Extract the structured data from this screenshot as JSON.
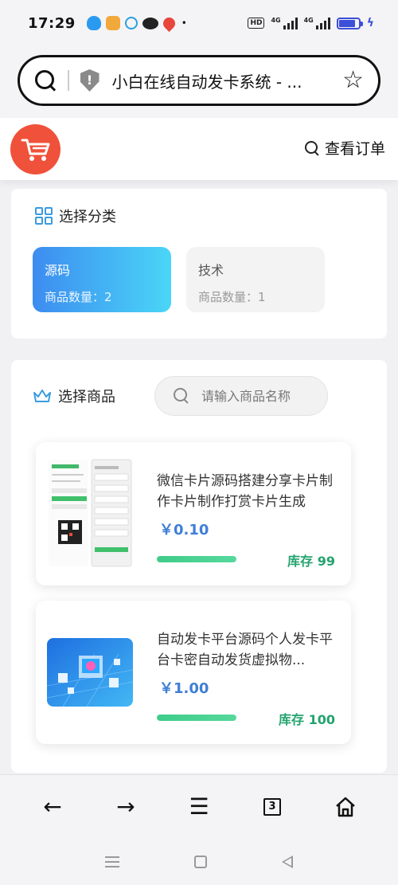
{
  "status_bar": {
    "time": "17:29",
    "dot": "•",
    "hd": "HD",
    "signal_1": "4G",
    "signal_2": "4G",
    "battery_percent": 85,
    "notification_icons": [
      "qq-icon",
      "video-icon",
      "chat-bubble-icon",
      "wechat-icon",
      "map-pin-icon"
    ]
  },
  "address_bar": {
    "title": "小白在线自动发卡系统 - ...",
    "security_icon": "shield-icon",
    "bookmark_icon": "star-icon"
  },
  "header": {
    "logo_icon": "shopping-cart-icon",
    "logo_color": "#f0513a",
    "order_link": "查看订单"
  },
  "category_section": {
    "title": "选择分类",
    "categories": [
      {
        "name": "源码",
        "count_label": "商品数量：2",
        "selected": true
      },
      {
        "name": "技术",
        "count_label": "商品数量：1",
        "selected": false
      }
    ]
  },
  "goods_section": {
    "title": "选择商品",
    "search_placeholder": "请输入商品名称",
    "products": [
      {
        "name": "微信卡片源码搭建分享卡片制作卡片制作打赏卡片生成",
        "price": "￥0.10",
        "stock_label": "库存 99",
        "stock_bar": 1.0
      },
      {
        "name": "自动发卡平台源码个人发卡平台卡密自动发货虚拟物...",
        "price": "￥1.00",
        "stock_label": "库存 100",
        "stock_bar": 1.0
      }
    ]
  },
  "browser_toolbar": {
    "back": "←",
    "forward": "→",
    "menu": "☰",
    "tabs_count": "3",
    "home_icon": "home-icon"
  },
  "colors": {
    "accent_blue": "#3f7ed6",
    "stock_green": "#23a36e",
    "category_gradient_start": "#3d8cf0",
    "category_gradient_end": "#4ad6f7"
  }
}
